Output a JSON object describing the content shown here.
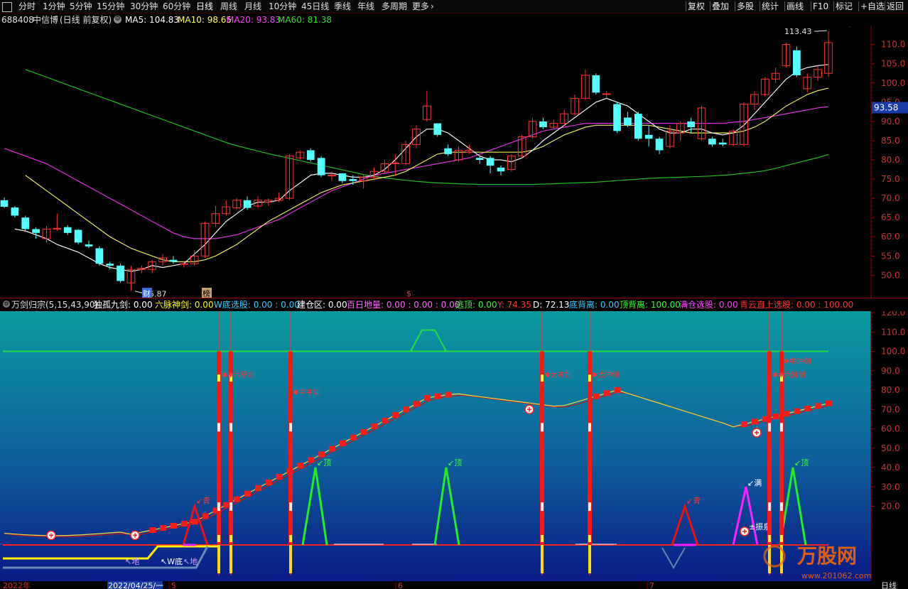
{
  "toolbar": {
    "periods": [
      "分时",
      "1分钟",
      "5分钟",
      "15分钟",
      "30分钟",
      "60分钟",
      "日线",
      "周线",
      "月线",
      "10分钟",
      "45日线",
      "季线",
      "年线",
      "多周期",
      "更多"
    ],
    "active_period": "日线",
    "right": [
      "复权",
      "叠加",
      "多股",
      "统计",
      "画线",
      "F10",
      "标记",
      "+自选",
      "返回"
    ]
  },
  "main_chart": {
    "stock_code": "688408",
    "stock_name": "中信博",
    "mode": "(日线 前复权)",
    "ma": [
      {
        "label": "MA5:",
        "value": "104.83",
        "color": "#ffffff"
      },
      {
        "label": "MA10:",
        "value": "98.65",
        "color": "#ffff55"
      },
      {
        "label": "MA20:",
        "value": "93.83",
        "color": "#ff44ff"
      },
      {
        "label": "MA60:",
        "value": "81.38",
        "color": "#33dd33"
      }
    ],
    "price_labels": [
      "110.0",
      "105.0",
      "100.0",
      "95.0",
      "90.0",
      "85.0",
      "80.0",
      "75.0",
      "70.0",
      "65.0",
      "60.0",
      "55.0",
      "50.0"
    ],
    "current_price": "93.58",
    "high_label": "113.43",
    "low_label": "45.87",
    "markers": [
      "财",
      "榜",
      "$"
    ]
  },
  "chart_data": {
    "type": "candlestick",
    "ylim": [
      46,
      114
    ],
    "candles": [
      [
        69.5,
        67.8,
        70.2,
        67.5
      ],
      [
        67.6,
        65.5,
        68.0,
        65.0
      ],
      [
        65.0,
        62.0,
        65.5,
        61.5
      ],
      [
        62.0,
        61.0,
        62.5,
        59.5
      ],
      [
        59.5,
        62.0,
        62.8,
        58.5
      ],
      [
        62.0,
        62.2,
        66.0,
        61.5
      ],
      [
        62.5,
        61.0,
        63.0,
        60.5
      ],
      [
        61.8,
        58.5,
        62.0,
        58.0
      ],
      [
        58.0,
        57.5,
        59.0,
        57.0
      ],
      [
        57.0,
        53.0,
        57.5,
        52.5
      ],
      [
        53.0,
        52.5,
        53.5,
        51.5
      ],
      [
        52.5,
        48.5,
        53.0,
        48.0
      ],
      [
        48.0,
        51.5,
        52.5,
        45.9
      ],
      [
        51.5,
        51.8,
        52.5,
        50.5
      ],
      [
        51.5,
        53.5,
        54.0,
        50.5
      ],
      [
        53.5,
        54.5,
        55.5,
        52.5
      ],
      [
        54.0,
        53.5,
        55.0,
        53.0
      ],
      [
        53.0,
        53.0,
        53.5,
        52.0
      ],
      [
        53.0,
        55.0,
        56.5,
        52.5
      ],
      [
        55.0,
        63.5,
        64.0,
        54.5
      ],
      [
        63.5,
        66.0,
        68.0,
        62.5
      ],
      [
        66.0,
        67.8,
        69.5,
        65.5
      ],
      [
        67.5,
        69.5,
        70.0,
        67.0
      ],
      [
        69.5,
        67.5,
        70.5,
        67.0
      ],
      [
        68.0,
        69.5,
        70.5,
        67.5
      ],
      [
        69.0,
        69.5,
        70.0,
        68.0
      ],
      [
        69.5,
        70.0,
        71.5,
        69.0
      ],
      [
        70.0,
        81.0,
        81.5,
        69.5
      ],
      [
        80.5,
        82.0,
        82.5,
        80.0
      ],
      [
        82.5,
        80.0,
        83.0,
        79.5
      ],
      [
        80.5,
        76.0,
        81.0,
        75.5
      ],
      [
        76.0,
        76.0,
        77.0,
        74.5
      ],
      [
        76.5,
        74.5,
        76.5,
        74.0
      ],
      [
        75.0,
        74.5,
        76.0,
        73.5
      ],
      [
        74.5,
        75.5,
        76.0,
        72.5
      ],
      [
        75.5,
        77.0,
        78.0,
        75.0
      ],
      [
        77.0,
        79.0,
        80.0,
        76.5
      ],
      [
        79.0,
        79.2,
        81.5,
        76.0
      ],
      [
        79.0,
        84.0,
        85.0,
        78.5
      ],
      [
        84.0,
        88.0,
        89.0,
        83.0
      ],
      [
        90.5,
        94.0,
        98.0,
        90.0
      ],
      [
        89.5,
        86.5,
        89.5,
        86.0
      ],
      [
        83.0,
        81.5,
        84.0,
        81.0
      ],
      [
        80.0,
        82.5,
        83.5,
        79.5
      ],
      [
        82.0,
        82.5,
        84.0,
        81.5
      ],
      [
        80.5,
        80.0,
        81.0,
        79.0
      ],
      [
        80.5,
        78.5,
        81.0,
        76.5
      ],
      [
        78.0,
        77.0,
        78.5,
        76.0
      ],
      [
        77.5,
        81.0,
        81.5,
        77.0
      ],
      [
        81.0,
        86.0,
        86.5,
        80.5
      ],
      [
        86.0,
        90.0,
        91.0,
        85.5
      ],
      [
        90.0,
        88.5,
        91.0,
        88.0
      ],
      [
        88.5,
        89.5,
        90.5,
        88.0
      ],
      [
        89.5,
        92.0,
        93.0,
        89.0
      ],
      [
        92.0,
        96.0,
        97.0,
        91.5
      ],
      [
        96.0,
        102.0,
        103.5,
        95.5
      ],
      [
        102.0,
        97.5,
        102.5,
        97.0
      ],
      [
        97.0,
        97.2,
        98.0,
        96.0
      ],
      [
        94.5,
        87.5,
        95.0,
        87.0
      ],
      [
        91.0,
        89.0,
        92.5,
        88.5
      ],
      [
        92.0,
        85.5,
        92.5,
        85.0
      ],
      [
        86.5,
        85.5,
        89.0,
        83.5
      ],
      [
        85.5,
        82.5,
        86.0,
        81.5
      ],
      [
        83.5,
        87.5,
        89.0,
        83.0
      ],
      [
        87.0,
        89.5,
        90.0,
        85.0
      ],
      [
        90.0,
        88.5,
        91.0,
        87.0
      ],
      [
        85.5,
        93.5,
        94.0,
        85.0
      ],
      [
        85.5,
        84.0,
        86.0,
        83.5
      ],
      [
        84.5,
        84.0,
        85.5,
        83.5
      ],
      [
        84.0,
        87.5,
        88.0,
        83.5
      ],
      [
        84.0,
        94.5,
        95.0,
        83.5
      ],
      [
        94.5,
        97.0,
        98.0,
        93.0
      ],
      [
        97.0,
        101.0,
        101.5,
        96.5
      ],
      [
        101.0,
        102.5,
        104.0,
        100.0
      ],
      [
        104.5,
        110.0,
        110.5,
        104.0
      ],
      [
        108.5,
        102.0,
        109.5,
        101.5
      ],
      [
        98.5,
        101.5,
        102.5,
        97.5
      ],
      [
        101.5,
        103.5,
        104.5,
        100.5
      ],
      [
        102.5,
        110.5,
        113.43,
        101.5
      ]
    ],
    "ma5": [
      62,
      61.5,
      60.5,
      59.5,
      58,
      57,
      56,
      54.5,
      53,
      52,
      51.5,
      51,
      51.5,
      52.5,
      52,
      52.5,
      53,
      55.5,
      58,
      61,
      64,
      66,
      68,
      69,
      69,
      69.5,
      72,
      74,
      76,
      76.5,
      76.5,
      76,
      75.5,
      75.5,
      76,
      77.5,
      80,
      83,
      86,
      88,
      88,
      87,
      85,
      83,
      81,
      80,
      80,
      79.5,
      80.5,
      82.5,
      85,
      87,
      89,
      91,
      93,
      95,
      96,
      95,
      94,
      92,
      90,
      88,
      87,
      87,
      88,
      88,
      87,
      86.5,
      87,
      89,
      92,
      95,
      98,
      101,
      103,
      104,
      104.5,
      104.8
    ],
    "ma10": [
      76,
      74,
      72,
      70,
      68,
      66,
      64,
      62,
      60,
      58.5,
      57,
      56,
      55,
      54,
      53.5,
      53.5,
      53.5,
      54,
      55,
      56.5,
      58,
      60,
      62,
      64,
      65.5,
      67,
      68.5,
      70,
      71.5,
      72.5,
      73.5,
      74,
      74.5,
      75,
      75.5,
      76,
      77,
      78.5,
      80,
      81.5,
      82,
      82,
      82,
      82,
      82,
      82,
      82,
      82,
      82.5,
      83.5,
      85,
      86.5,
      87.5,
      88.5,
      89,
      89,
      89,
      89,
      89,
      89,
      88.5,
      88,
      87.5,
      87,
      87,
      87,
      87,
      87,
      87.5,
      88.5,
      90,
      92,
      94,
      95.5,
      97,
      98,
      98.65
    ],
    "ma20": [
      83,
      82,
      81,
      80,
      79,
      77.5,
      76,
      74.5,
      73,
      71.5,
      70,
      68.5,
      67,
      65.5,
      64,
      62.5,
      61,
      60,
      59.5,
      59.5,
      59.5,
      60,
      60.5,
      61.5,
      62.5,
      63.5,
      64.5,
      66,
      67.5,
      69,
      70.5,
      72,
      73,
      74,
      75,
      76,
      76.5,
      77,
      77.5,
      78,
      78.5,
      79,
      79.5,
      80,
      80.5,
      81.5,
      82.5,
      83.5,
      84.5,
      85.5,
      86.5,
      87.5,
      88,
      88.5,
      89,
      89.5,
      89.5,
      89.5,
      89.5,
      89.5,
      89.5,
      89.5,
      89.5,
      89.5,
      89.5,
      89.5,
      89.5,
      89.5,
      89.5,
      89.8,
      90,
      90.5,
      91,
      91.5,
      92,
      92.5,
      93,
      93.5,
      93.83
    ],
    "ma60": [
      103.5,
      102.5,
      101.5,
      100.5,
      99.5,
      98.5,
      97.5,
      96.5,
      95.5,
      94.5,
      93.5,
      92.5,
      91.5,
      90.5,
      89.5,
      88.5,
      87.5,
      86.5,
      85.5,
      84.5,
      83.7,
      83,
      82.3,
      81.6,
      81,
      80.4,
      79.8,
      79.2,
      78.6,
      78,
      77.4,
      76.8,
      76.2,
      75.7,
      75.3,
      75,
      74.7,
      74.4,
      74.2,
      74,
      73.9,
      73.8,
      73.7,
      73.6,
      73.6,
      73.6,
      73.6,
      73.6,
      73.6,
      73.7,
      73.8,
      73.9,
      74,
      74.1,
      74.2,
      74.4,
      74.6,
      74.8,
      75,
      75.2,
      75.3,
      75.4,
      75.5,
      75.6,
      75.7,
      75.8,
      76,
      76.2,
      76.5,
      76.8,
      77.2,
      77.8,
      78.5,
      79.2,
      79.9,
      80.6,
      81.38
    ]
  },
  "indicator": {
    "title": "万剑归宗(5,15,43,90)",
    "items": [
      {
        "text": "独孤九剑: 0.00",
        "color": "#ffffff"
      },
      {
        "text": "六脉神剑: 0.00",
        "color": "#ffff00"
      },
      {
        "text": "W底选股: 0.00 : 0.00",
        "color": "#33ccff"
      },
      {
        "text": "建仓区: 0.00",
        "color": "#ffffff"
      },
      {
        "text": "百日地量: 0.00 : 0.00 : 0.00",
        "color": "#ff66ff"
      },
      {
        "text": "逃顶: 0.00",
        "color": "#33ff33"
      },
      {
        "text": "Y: 74.35",
        "color": "#ff3333"
      },
      {
        "text": "D: 72.13",
        "color": "#ffffff"
      },
      {
        "text": "底背离: 0.00",
        "color": "#33ccff"
      },
      {
        "text": "顶背离: 100.00",
        "color": "#33ff33"
      },
      {
        "text": "满仓选股: 0.00",
        "color": "#ff44ff"
      },
      {
        "text": "青云直上选股: 0.00 : 100.00",
        "color": "#ff3333"
      }
    ],
    "axis_labels": [
      "120.0",
      "110.0",
      "100.0",
      "90.0",
      "80.0",
      "70.0",
      "60.0",
      "50.0",
      "40.0",
      "30.0",
      "20.0"
    ],
    "annotations": {
      "ding": "顶",
      "qing": "青",
      "man": "满",
      "zhenyuan": "振泉",
      "di": "地",
      "wdi": "W底",
      "liu_mai": "六脉剑",
      "qi_chong": "中冲剑",
      "tai_chong": "太冲剑"
    }
  },
  "date_axis": {
    "labels": [
      "2022年",
      "2022/04/25/一",
      "5",
      "6",
      "7"
    ],
    "period_label": "日线"
  },
  "watermark": {
    "text": "万股网",
    "url": "www.201062.com"
  }
}
